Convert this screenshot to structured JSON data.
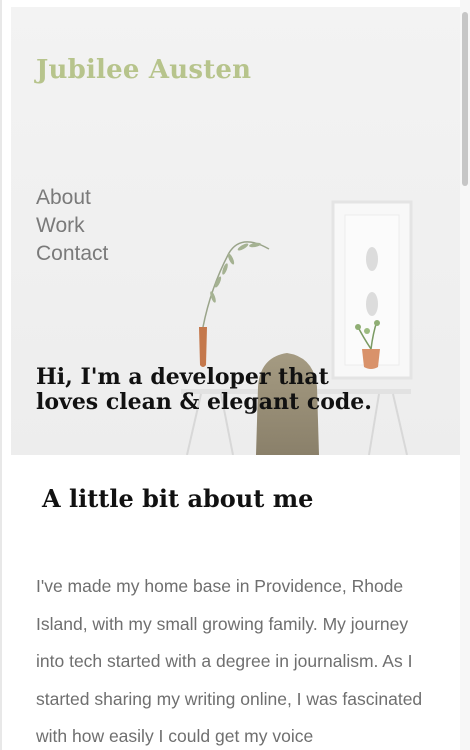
{
  "header": {
    "site_title": "Jubilee Austen",
    "nav": [
      "About",
      "Work",
      "Contact"
    ],
    "tagline": "Hi, I'm a developer that loves clean & elegant code."
  },
  "about": {
    "heading": "A little bit about me",
    "body": "I've made my home base in Providence, Rhode Island, with my small growing family. My journey into tech started with a degree in journalism. As I started sharing my writing online, I was fascinated with how easily I could get my voice"
  },
  "colors": {
    "title_accent": "#b7c48c",
    "nav_text": "#7a7a7a",
    "body_text": "#6f6f6f",
    "heading_text": "#111111"
  }
}
